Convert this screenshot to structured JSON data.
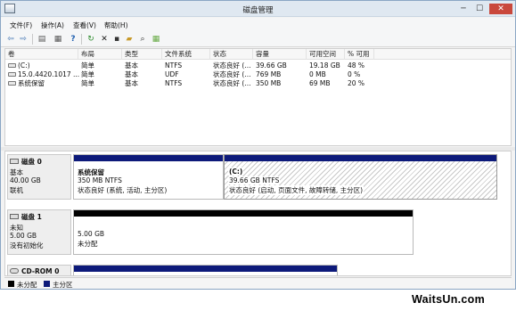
{
  "window": {
    "title": "磁盘管理",
    "minimize": "─",
    "maximize": "☐",
    "close": "✕"
  },
  "menu": [
    "文件(F)",
    "操作(A)",
    "查看(V)",
    "帮助(H)"
  ],
  "toolbar": {
    "icons": [
      "back-arrow-icon",
      "forward-arrow-icon",
      "properties-pane-icon",
      "help-icon",
      "refresh-icon",
      "delete-icon",
      "new-volume-icon",
      "open-folder-icon",
      "search-icon",
      "properties-icon"
    ],
    "glyphs": [
      "⇦",
      "⇨",
      "▤",
      "?",
      "↻",
      "✕",
      "▪",
      "▰",
      "⌕",
      "▦"
    ]
  },
  "volumes": {
    "headers": [
      "卷",
      "布局",
      "类型",
      "文件系统",
      "状态",
      "容量",
      "可用空间",
      "% 可用"
    ],
    "rows": [
      [
        "(C:)",
        "简单",
        "基本",
        "NTFS",
        "状态良好 (...",
        "39.66 GB",
        "19.18 GB",
        "48 %"
      ],
      [
        "15.0.4420.1017 ...",
        "简单",
        "基本",
        "UDF",
        "状态良好 (...",
        "769 MB",
        "0 MB",
        "0 %"
      ],
      [
        "系统保留",
        "简单",
        "基本",
        "NTFS",
        "状态良好 (...",
        "350 MB",
        "69 MB",
        "20 %"
      ]
    ]
  },
  "disks": [
    {
      "name": "磁盘 0",
      "lines": [
        "基本",
        "40.00 GB",
        "联机"
      ],
      "partitions": [
        {
          "title": "系统保留",
          "size": "350 MB NTFS",
          "status": "状态良好 (系统, 活动, 主分区)"
        },
        {
          "title": "(C:)",
          "size": "39.66 GB NTFS",
          "status": "状态良好 (启动, 页面文件, 故障转储, 主分区)"
        }
      ]
    },
    {
      "name": "磁盘 1",
      "lines": [
        "未知",
        "5.00 GB",
        "没有初始化"
      ],
      "partitions": [
        {
          "size": "5.00 GB",
          "status": "未分配"
        }
      ]
    },
    {
      "name": "CD-ROM 0",
      "lines": [],
      "partitions": []
    }
  ],
  "legend": [
    {
      "label": "未分配",
      "color": "#000000"
    },
    {
      "label": "主分区",
      "color": "#0d1a7a"
    }
  ],
  "watermark": "WaitsUn.com"
}
